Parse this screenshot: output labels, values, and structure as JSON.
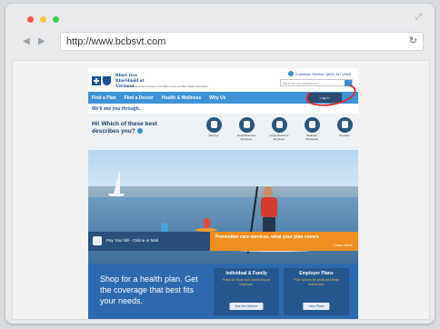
{
  "browser": {
    "url": "http://www.bcbsvt.com",
    "traffic_colors": [
      "#ff4d4d",
      "#f9c63a",
      "#3fcf4e"
    ]
  },
  "site": {
    "logo_name": "BlueCross BlueShield of Vermont",
    "logo_tag": "An independent licensee of the Blue Cross and Blue Shield Association",
    "customer_service": "Customer Service: (800) 247-2583",
    "search_placeholder": "What are you looking for?",
    "nav": [
      "Find a Plan",
      "Find a Doctor",
      "Health & Wellness",
      "Why Us"
    ],
    "login": "Log in",
    "subtitle": "We'll see you through.",
    "welcome_question": "Hi! Which of these best describes you?",
    "audiences": [
      "Member",
      "Small Business Employer",
      "Large Business Employer",
      "Medicare Participant",
      "Provider"
    ],
    "pay_text": "Pay Your Bill - Online or Mail",
    "preventive_text": "Preventive care services, what your plan covers",
    "preventive_link": "Learn More",
    "shop_text": "Shop for a health plan. Get the coverage that best fits your needs.",
    "plans": [
      {
        "title": "Individual & Family",
        "desc": "Plans for those not covered by an employer.",
        "button": "See the Options"
      },
      {
        "title": "Employer Plans",
        "desc": "Plan options for small and large businesses.",
        "button": "View Plans"
      }
    ],
    "accent_blue": "#3d93d6",
    "accent_orange": "#ef8e1f",
    "annotation_color": "#e42b2b"
  }
}
